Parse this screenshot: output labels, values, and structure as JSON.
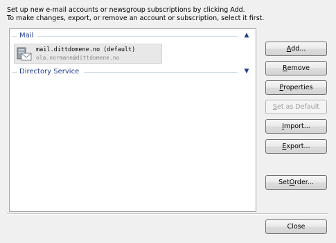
{
  "intro": {
    "line1": "Set up new e-mail accounts or newsgroup subscriptions by clicking Add.",
    "line2": "To make changes, export, or remove an account or subscription, select it first."
  },
  "list": {
    "mail_group": {
      "title": "Mail",
      "chevron": "up-chevron-icon"
    },
    "account": {
      "name": "mail.dittdomene.no (default)",
      "email": "ola.normann@dittdomene.no",
      "icon": "mail-account-icon"
    },
    "directory_group": {
      "title": "Directory Service",
      "chevron": "down-chevron-icon"
    }
  },
  "buttons": {
    "add": {
      "pre": "",
      "key": "A",
      "post": "dd..."
    },
    "remove": {
      "pre": "",
      "key": "R",
      "post": "emove"
    },
    "properties": {
      "pre": "",
      "key": "P",
      "post": "roperties"
    },
    "set_default": {
      "pre": "",
      "key": "S",
      "post": "et as Default",
      "disabled": true
    },
    "import": {
      "pre": "",
      "key": "I",
      "post": "mport..."
    },
    "export": {
      "pre": "",
      "key": "E",
      "post": "xport..."
    },
    "set_order": {
      "pre": "Set ",
      "key": "O",
      "post": "rder..."
    },
    "close": {
      "pre": "",
      "key": "",
      "post": "Close"
    }
  },
  "colors": {
    "group_header": "#1e3d8f",
    "window_bg": "#f0f0f0"
  }
}
